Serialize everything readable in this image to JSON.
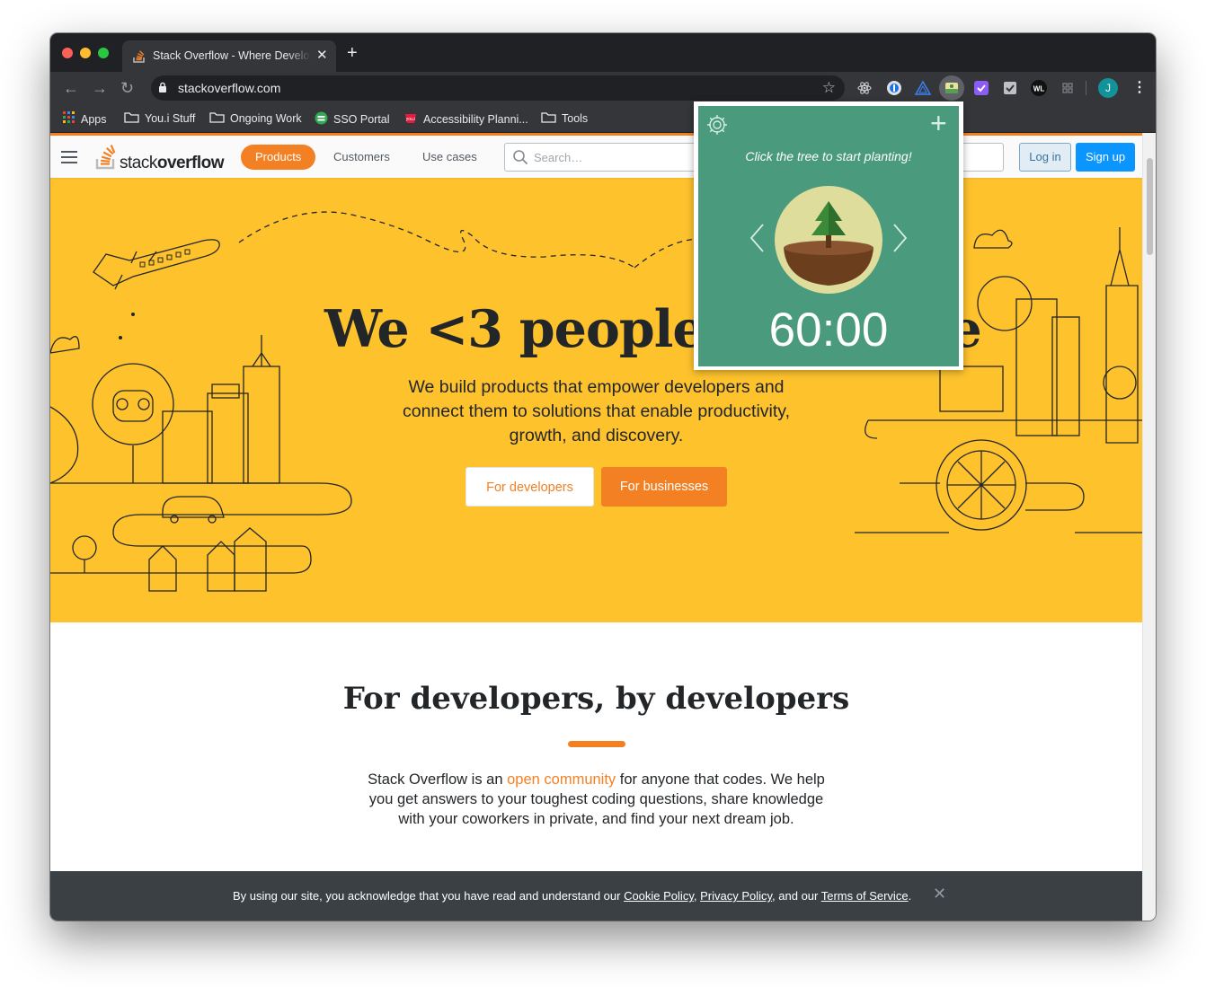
{
  "browser": {
    "tab_title": "Stack Overflow - Where Developers Learn, Share, & Build Careers",
    "url": "stackoverflow.com",
    "avatar_letter": "J",
    "bookmarks": [
      {
        "label": "Apps",
        "icon": "apps-grid-icon"
      },
      {
        "label": "You.i Stuff",
        "icon": "folder-icon"
      },
      {
        "label": "Ongoing Work",
        "icon": "folder-icon"
      },
      {
        "label": "SSO Portal",
        "icon": "sso-icon"
      },
      {
        "label": "Accessibility Planni...",
        "icon": "youi-icon"
      },
      {
        "label": "Tools",
        "icon": "folder-icon"
      }
    ]
  },
  "so_header": {
    "logo_light": "stack",
    "logo_bold": "overflow",
    "nav": [
      "Products",
      "Customers",
      "Use cases"
    ],
    "search_placeholder": "Search…",
    "login": "Log in",
    "signup": "Sign up"
  },
  "hero": {
    "title": "We <3 people who code",
    "subtitle": "We build products that empower developers and connect them to solutions that enable productivity, growth, and discovery.",
    "btn_developers": "For developers",
    "btn_businesses": "For businesses"
  },
  "section": {
    "title": "For developers, by developers",
    "body_before": "Stack Overflow is an ",
    "body_link": "open community",
    "body_after": " for anyone that codes. We help you get answers to your toughest coding questions, share knowledge with your coworkers in private, and find your next dream job."
  },
  "cookie": {
    "prefix": "By using our site, you acknowledge that you have read and understand our ",
    "cookie_policy": "Cookie Policy",
    "sep1": ", ",
    "privacy_policy": "Privacy Policy",
    "sep2": ", and our ",
    "terms": "Terms of Service",
    "end": "."
  },
  "forest_popup": {
    "hint": "Click the tree to start planting!",
    "timer": "60:00"
  },
  "colors": {
    "so_orange": "#f48024",
    "hero_yellow": "#fec22d",
    "forest_green": "#4a9a7d",
    "chrome_dark": "#35363a"
  }
}
